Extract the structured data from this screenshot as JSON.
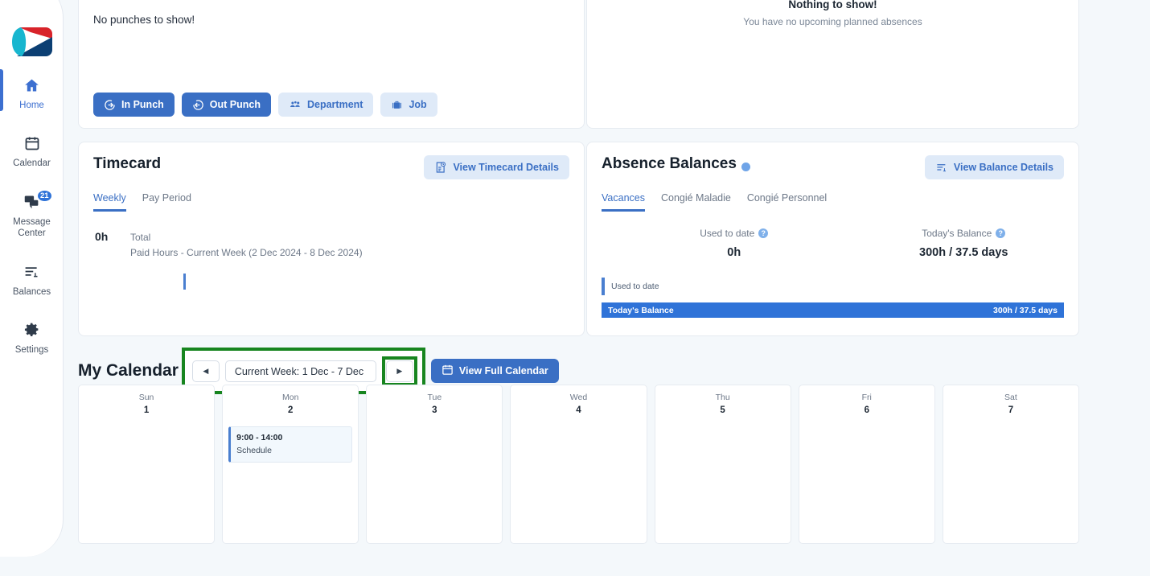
{
  "sidebar": {
    "logo_alt": "company-logo",
    "items": [
      {
        "label": "Home",
        "icon": "home-icon",
        "active": true,
        "badge": null
      },
      {
        "label": "Calendar",
        "icon": "calendar-icon",
        "active": false,
        "badge": null
      },
      {
        "label": "Message Center",
        "icon": "message-icon",
        "active": false,
        "badge": "21"
      },
      {
        "label": "Balances",
        "icon": "balances-icon",
        "active": false,
        "badge": null
      },
      {
        "label": "Settings",
        "icon": "gear-icon",
        "active": false,
        "badge": null
      }
    ]
  },
  "punch_card": {
    "empty_text": "No punches to show!",
    "buttons": [
      {
        "label": "In Punch",
        "icon": "arrow-into-circle-icon",
        "style": "primary"
      },
      {
        "label": "Out Punch",
        "icon": "arrow-out-of-circle-icon",
        "style": "primary"
      },
      {
        "label": "Department",
        "icon": "people-group-icon",
        "style": "soft"
      },
      {
        "label": "Job",
        "icon": "briefcase-icon",
        "style": "soft"
      }
    ]
  },
  "upcoming_absences": {
    "empty_title": "Nothing to show!",
    "empty_subtitle": "You have no upcoming planned absences",
    "illustration": "documents-clipboard-illustration"
  },
  "timecard": {
    "title": "Timecard",
    "details_button": "View Timecard Details",
    "details_icon": "timecard-report-icon",
    "tabs": [
      {
        "label": "Weekly",
        "active": true
      },
      {
        "label": "Pay Period",
        "active": false
      }
    ],
    "total_hours": "0h",
    "total_label": "Total",
    "total_sub": "Paid Hours - Current Week (2 Dec 2024 - 8 Dec 2024)"
  },
  "absence_balances": {
    "title": "Absence Balances",
    "title_info_icon": "info-icon",
    "details_button": "View Balance Details",
    "details_icon": "list-details-icon",
    "tabs": [
      {
        "label": "Vacances",
        "active": true
      },
      {
        "label": "Congié Maladie",
        "active": false
      },
      {
        "label": "Congié Personnel",
        "active": false
      }
    ],
    "columns": [
      {
        "label": "Used to date",
        "help_icon": "?",
        "value": "0h"
      },
      {
        "label": "Today's Balance",
        "help_icon": "?",
        "value": "300h / 37.5 days"
      }
    ],
    "bars": [
      {
        "label": "Used to date",
        "value": "",
        "filled": false
      },
      {
        "label": "Today's Balance",
        "value": "300h / 37.5 days",
        "filled": true
      }
    ]
  },
  "my_calendar": {
    "title": "My Calendar",
    "prev_arrow": "◀",
    "next_arrow": "▶",
    "week_label": "Current Week: 1 Dec - 7 Dec",
    "full_calendar_button": "View Full Calendar",
    "full_calendar_icon": "calendar-icon",
    "days": [
      {
        "name": "Sun",
        "num": "1",
        "events": []
      },
      {
        "name": "Mon",
        "num": "2",
        "events": [
          {
            "time": "9:00 - 14:00",
            "name": "Schedule"
          }
        ]
      },
      {
        "name": "Tue",
        "num": "3",
        "events": []
      },
      {
        "name": "Wed",
        "num": "4",
        "events": []
      },
      {
        "name": "Thu",
        "num": "5",
        "events": []
      },
      {
        "name": "Fri",
        "num": "6",
        "events": []
      },
      {
        "name": "Sat",
        "num": "7",
        "events": []
      }
    ]
  },
  "highlight": {
    "color": "#17851f",
    "targets": [
      "week-navigation-group",
      "week-next-button"
    ]
  },
  "colors": {
    "accent": "#3a6fc4",
    "accent_soft": "#dfeaf8",
    "bar_fill": "#2f73d8",
    "page_bg": "#f4f8fb",
    "highlight_green": "#17851f"
  }
}
